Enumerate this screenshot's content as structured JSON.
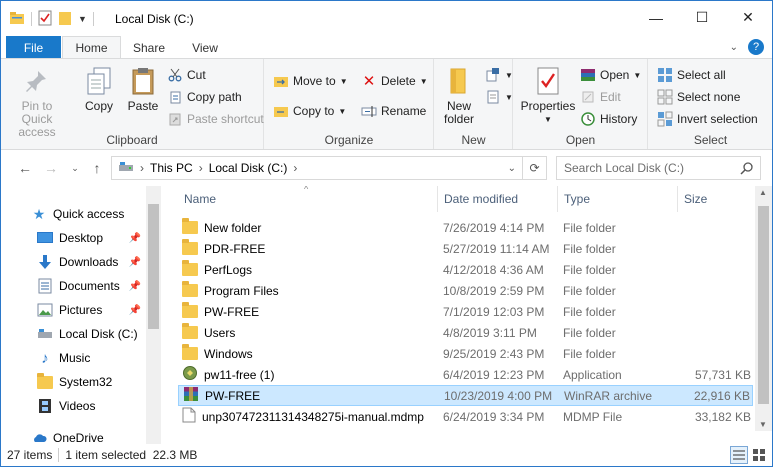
{
  "window": {
    "title": "Local Disk (C:)",
    "controls": {
      "minimize": "—",
      "maximize": "☐",
      "close": "✕"
    }
  },
  "tabs": {
    "file": "File",
    "home": "Home",
    "share": "Share",
    "view": "View",
    "help_icon": "?"
  },
  "ribbon": {
    "clipboard": {
      "label": "Clipboard",
      "pin": "Pin to Quick access",
      "copy": "Copy",
      "paste": "Paste",
      "cut": "Cut",
      "copy_path": "Copy path",
      "paste_shortcut": "Paste shortcut"
    },
    "organize": {
      "label": "Organize",
      "move_to": "Move to",
      "copy_to": "Copy to",
      "delete": "Delete",
      "rename": "Rename"
    },
    "new": {
      "label": "New",
      "new_folder": "New folder"
    },
    "open": {
      "label": "Open",
      "properties": "Properties",
      "open": "Open",
      "edit": "Edit",
      "history": "History"
    },
    "select": {
      "label": "Select",
      "select_all": "Select all",
      "select_none": "Select none",
      "invert": "Invert selection"
    }
  },
  "address": {
    "crumbs": [
      "This PC",
      "Local Disk (C:)"
    ],
    "search_placeholder": "Search Local Disk (C:)"
  },
  "nav": {
    "items": [
      {
        "label": "Quick access",
        "pinned": false
      },
      {
        "label": "Desktop",
        "pinned": true
      },
      {
        "label": "Downloads",
        "pinned": true
      },
      {
        "label": "Documents",
        "pinned": true
      },
      {
        "label": "Pictures",
        "pinned": true
      },
      {
        "label": "Local Disk (C:)",
        "pinned": false
      },
      {
        "label": "Music",
        "pinned": false
      },
      {
        "label": "System32",
        "pinned": false
      },
      {
        "label": "Videos",
        "pinned": false
      },
      {
        "label": "OneDrive",
        "pinned": false
      }
    ]
  },
  "columns": {
    "name": "Name",
    "date": "Date modified",
    "type": "Type",
    "size": "Size"
  },
  "files": [
    {
      "name": "New folder",
      "date": "7/26/2019 4:14 PM",
      "type": "File folder",
      "size": "",
      "icon": "folder"
    },
    {
      "name": "PDR-FREE",
      "date": "5/27/2019 11:14 AM",
      "type": "File folder",
      "size": "",
      "icon": "folder"
    },
    {
      "name": "PerfLogs",
      "date": "4/12/2018 4:36 AM",
      "type": "File folder",
      "size": "",
      "icon": "folder"
    },
    {
      "name": "Program Files",
      "date": "10/8/2019 2:59 PM",
      "type": "File folder",
      "size": "",
      "icon": "folder"
    },
    {
      "name": "PW-FREE",
      "date": "7/1/2019 12:03 PM",
      "type": "File folder",
      "size": "",
      "icon": "folder"
    },
    {
      "name": "Users",
      "date": "4/8/2019 3:11 PM",
      "type": "File folder",
      "size": "",
      "icon": "folder"
    },
    {
      "name": "Windows",
      "date": "9/25/2019 2:43 PM",
      "type": "File folder",
      "size": "",
      "icon": "folder"
    },
    {
      "name": "pw11-free (1)",
      "date": "6/4/2019 12:23 PM",
      "type": "Application",
      "size": "57,731 KB",
      "icon": "app"
    },
    {
      "name": "PW-FREE",
      "date": "10/23/2019 4:00 PM",
      "type": "WinRAR archive",
      "size": "22,916 KB",
      "icon": "rar"
    },
    {
      "name": "unp307472311314348275i-manual.mdmp",
      "date": "6/24/2019 3:34 PM",
      "type": "MDMP File",
      "size": "33,182 KB",
      "icon": "doc"
    }
  ],
  "status": {
    "items": "27 items",
    "selected": "1 item selected  22.3 MB"
  },
  "colors": {
    "accent": "#1979ca",
    "selection_bg": "#cce8ff",
    "selection_border": "#99d1ff"
  }
}
